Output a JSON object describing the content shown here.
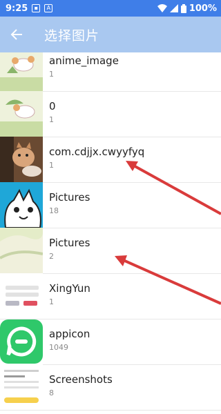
{
  "status_bar": {
    "time": "9:25",
    "battery": "100%"
  },
  "app_bar": {
    "title": "选择图片"
  },
  "folders": [
    {
      "name": "anime_image",
      "count": "1"
    },
    {
      "name": "0",
      "count": "1"
    },
    {
      "name": "com.cdjjx.cwyyfyq",
      "count": "1"
    },
    {
      "name": "Pictures",
      "count": "18"
    },
    {
      "name": "Pictures",
      "count": "2"
    },
    {
      "name": "XingYun",
      "count": "1"
    },
    {
      "name": "appicon",
      "count": "1049"
    },
    {
      "name": "Screenshots",
      "count": "8"
    }
  ],
  "colors": {
    "status_bar": "#3f7ee8",
    "app_bar": "#a9c8f0",
    "annotation_arrow": "#d93b3b",
    "appicon_green": "#2fc86a"
  }
}
